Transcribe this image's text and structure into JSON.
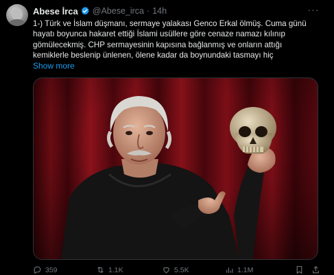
{
  "tweet": {
    "author_name": "Abese İrca",
    "handle": "@Abese_irca",
    "separator": "·",
    "time": "14h",
    "more_glyph": "···",
    "text_lines": [
      "1-) Türk ve İslam düşmanı, sermaye yalakası Genco Erkal ölmüş. Cuma günü",
      "hayatı boyunca hakaret ettiği İslami usüllere göre cenaze namazı kılınıp",
      "gömülecekmiş. CHP sermayesinin kapısına bağlanmış ve onların attığı",
      "kemiklerle beslenip ünlenen, ölene kadar da boynundaki tasmayı hiç"
    ],
    "show_more": "Show more",
    "verified_color": "#1d9bf0",
    "link_color": "#1d9bf0",
    "media": {
      "icons": [
        "person-figure",
        "skull-prop"
      ]
    }
  },
  "actions": {
    "replies": "359",
    "reposts": "1.1K",
    "likes": "5.5K",
    "views": "1.1M",
    "icons": [
      "reply-icon",
      "repost-icon",
      "like-icon",
      "views-icon",
      "bookmark-icon",
      "share-icon"
    ]
  }
}
